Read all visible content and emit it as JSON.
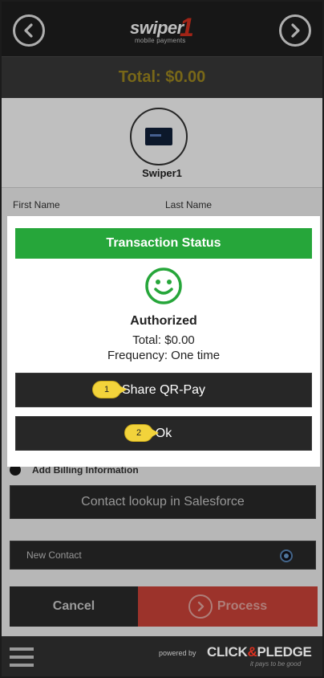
{
  "header": {
    "back_icon": "chevron-left-icon",
    "forward_icon": "chevron-right-icon",
    "logo_word": "swiper",
    "logo_number": "1",
    "logo_sub": "mobile payments"
  },
  "total_bar": {
    "text": "Total: $0.00"
  },
  "device": {
    "label": "Swiper1"
  },
  "form": {
    "first_name_label": "First Name",
    "last_name_label": "Last Name",
    "billing_label": "Add Billing Information",
    "lookup_button": "Contact lookup in Salesforce",
    "new_contact_label": "New Contact"
  },
  "actions": {
    "cancel_label": "Cancel",
    "process_label": "Process"
  },
  "modal": {
    "title": "Transaction Status",
    "status": "Authorized",
    "total": "Total: $0.00",
    "frequency": "Frequency: One time",
    "share_button": "Share QR-Pay",
    "ok_button": "Ok",
    "callout_1": "1",
    "callout_2": "2"
  },
  "footer": {
    "powered_by": "powered by",
    "brand_left": "CLICK",
    "brand_amp": "&",
    "brand_right": "PLEDGE",
    "tagline": "it pays to be good"
  },
  "colors": {
    "accent_green": "#26a63a",
    "process_red": "#d0453a",
    "total_gold": "#a08a20",
    "callout_yellow": "#f2d33b"
  }
}
